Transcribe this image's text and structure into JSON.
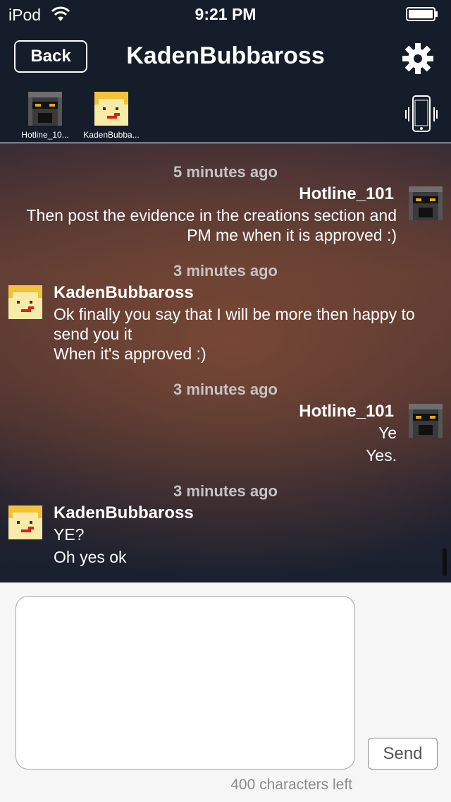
{
  "status_bar": {
    "carrier": "iPod",
    "time": "9:21 PM"
  },
  "nav": {
    "back_label": "Back",
    "title": "KadenBubbaross"
  },
  "participants": [
    {
      "name": "Hotline_10...",
      "avatar": "robot-avatar"
    },
    {
      "name": "KadenBubba...",
      "avatar": "smiley-avatar"
    }
  ],
  "messages": [
    {
      "timestamp": "5 minutes ago",
      "sender": "Hotline_101",
      "side": "right",
      "avatar": "robot-avatar",
      "lines": [
        "Then post the evidence in the creations section and",
        "PM me when it is approved :)"
      ]
    },
    {
      "timestamp": "3 minutes ago",
      "sender": "KadenBubbaross",
      "side": "left",
      "avatar": "smiley-avatar",
      "lines": [
        "Ok finally you say that I will be more then happy to",
        "send you it",
        "When it's approved :)"
      ]
    },
    {
      "timestamp": "3 minutes ago",
      "sender": "Hotline_101",
      "side": "right",
      "avatar": "robot-avatar",
      "lines": [
        "Ye",
        "Yes."
      ]
    },
    {
      "timestamp": "3 minutes ago",
      "sender": "KadenBubbaross",
      "side": "left",
      "avatar": "smiley-avatar",
      "lines": [
        "YE?",
        "Oh yes ok"
      ]
    }
  ],
  "compose": {
    "placeholder": "",
    "send_label": "Send",
    "chars_left": "400 characters left"
  },
  "colors": {
    "bar_background": "#141d29",
    "accent": "#ffffff"
  }
}
